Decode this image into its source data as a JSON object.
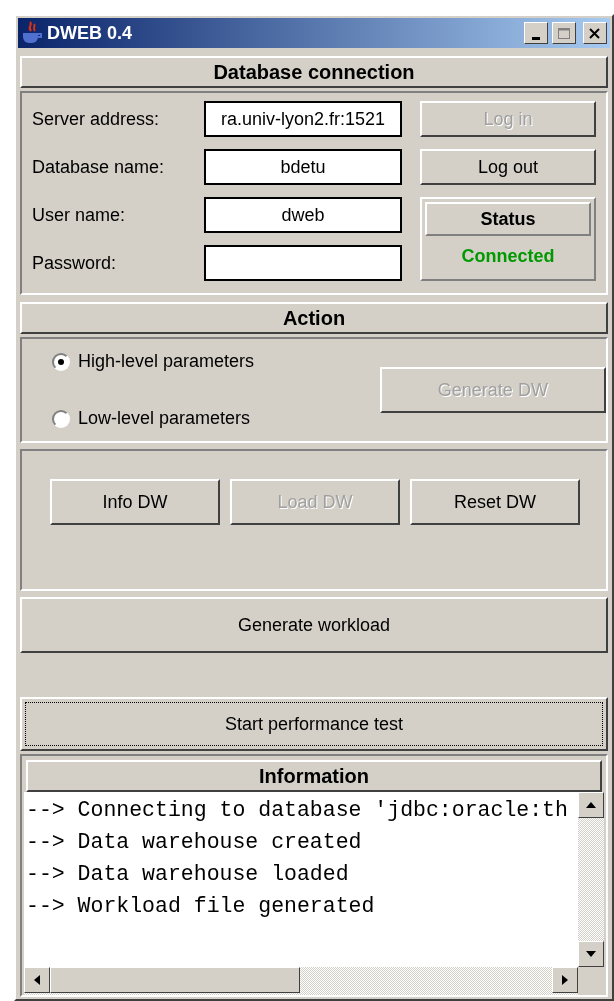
{
  "window": {
    "title": "DWEB 0.4"
  },
  "connection": {
    "header": "Database connection",
    "fields": [
      {
        "label": "Server address:",
        "value": "ra.univ-lyon2.fr:1521"
      },
      {
        "label": "Database name:",
        "value": "bdetu"
      },
      {
        "label": "User name:",
        "value": "dweb"
      },
      {
        "label": "Password:"
      }
    ],
    "buttons": [
      {
        "label": "Log in",
        "disabled": true
      },
      {
        "label": "Log out",
        "disabled": false
      }
    ],
    "status": {
      "header": "Status",
      "value": "Connected",
      "color": "#009a00"
    }
  },
  "action": {
    "header": "Action",
    "radios": [
      {
        "label": "High-level parameters",
        "selected": true
      },
      {
        "label": "Low-level parameters",
        "selected": false
      }
    ],
    "generate_button": {
      "label": "Generate DW",
      "disabled": true
    },
    "dw_buttons": [
      {
        "label": "Info DW",
        "disabled": false
      },
      {
        "label": "Load DW",
        "disabled": true
      },
      {
        "label": "Reset DW",
        "disabled": false
      }
    ],
    "workload_button": {
      "label": "Generate workload",
      "focused": false
    },
    "test_button": {
      "label": "Start performance test",
      "focused": true
    }
  },
  "information": {
    "header": "Information",
    "lines": [
      "--> Connecting to database 'jdbc:oracle:th",
      "--> Data warehouse created",
      "--> Data warehouse loaded",
      "--> Workload file generated"
    ]
  }
}
